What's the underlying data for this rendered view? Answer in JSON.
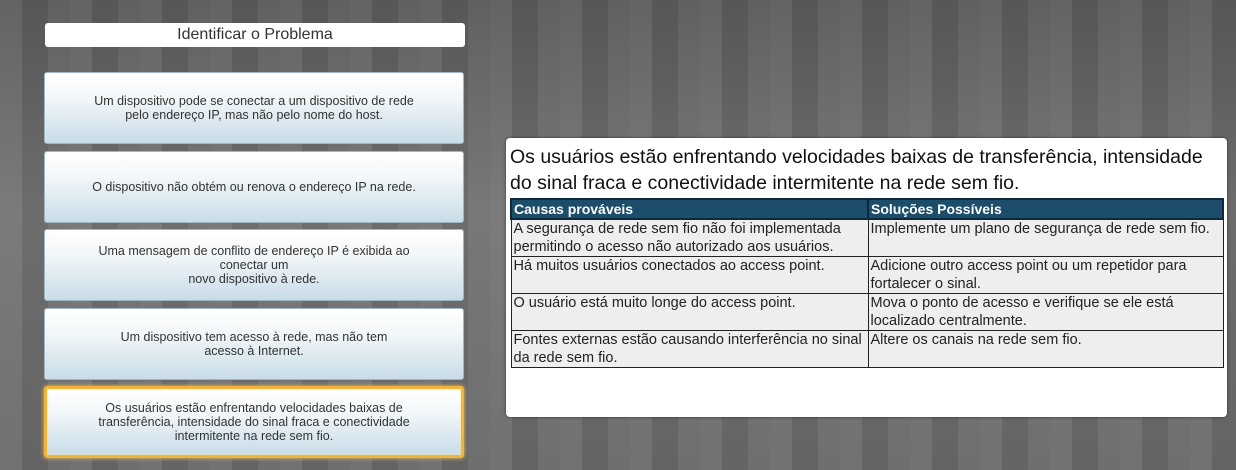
{
  "header": {
    "title": "Identificar o Problema"
  },
  "options": [
    {
      "label": "Um dispositivo pode se conectar a um dispositivo de rede\npelo endereço IP, mas não pelo nome do host."
    },
    {
      "label": "O dispositivo não obtém ou renova o endereço IP na rede."
    },
    {
      "label": "Uma mensagem de conflito de endereço IP é exibida ao\nconectar um\nnovo dispositivo à rede."
    },
    {
      "label": "Um dispositivo tem acesso à rede, mas não tem\nacesso à Internet."
    },
    {
      "label": "Os usuários estão enfrentando velocidades baixas de\ntransferência, intensidade do sinal fraca e conectividade\nintermitente na rede sem fio."
    }
  ],
  "selected_index": 4,
  "answer": {
    "heading": "Os usuários estão enfrentando velocidades baixas de transferência, intensidade do sinal fraca e conectividade intermitente na rede sem fio.",
    "table": {
      "headers": [
        "Causas prováveis",
        "Soluções Possíveis"
      ],
      "rows": [
        [
          "A segurança de rede sem fio não foi implementada permitindo o acesso não autorizado aos usuários.",
          "Implemente um plano de segurança de rede sem fio."
        ],
        [
          "Há muitos usuários conectados ao access point.",
          "Adicione outro access point ou um repetidor para fortalecer o sinal."
        ],
        [
          "O usuário está muito longe do access point.",
          "Mova o ponto de acesso e verifique se ele está localizado centralmente."
        ],
        [
          "Fontes externas estão causando interferência no sinal da rede sem fio.",
          "Altere os canais na rede sem fio."
        ]
      ]
    }
  },
  "colors": {
    "table_header_bg": "#1c4d6b",
    "selected_border": "#f2b33a",
    "option_gradient_bottom": "#c8dce8"
  }
}
